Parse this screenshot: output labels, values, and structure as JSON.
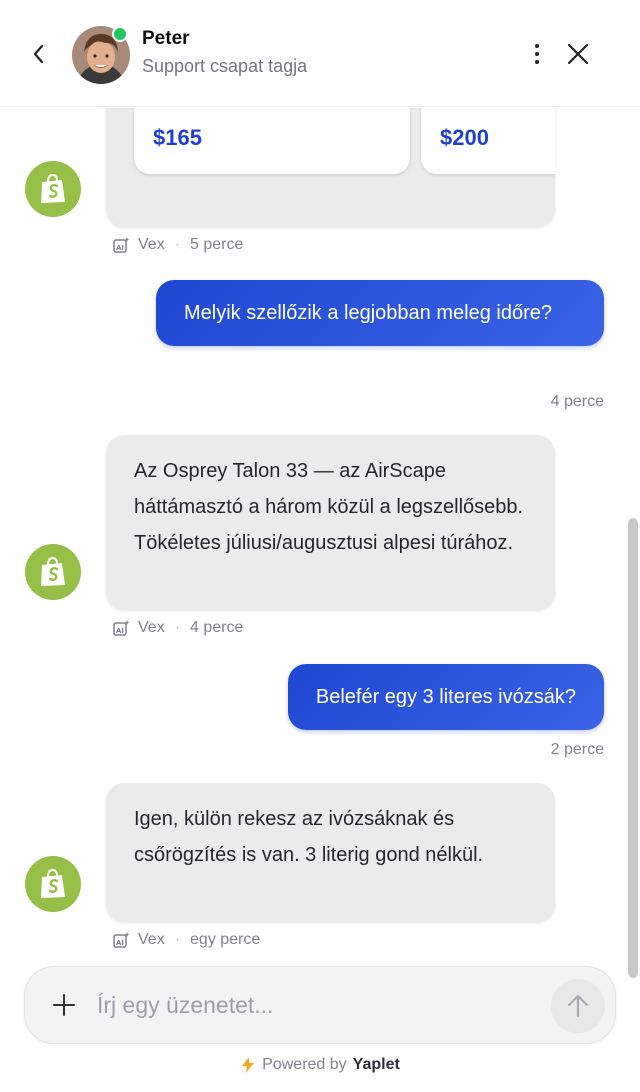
{
  "header": {
    "agent_name": "Peter",
    "agent_role": "Support csapat tagja",
    "status_color": "#22c55e"
  },
  "messages": {
    "carousel": {
      "products": [
        {
          "price": "$165"
        },
        {
          "price": "$200"
        }
      ],
      "sender": "Vex",
      "time": "5 perce"
    },
    "user1": {
      "text": "Melyik szellőzik a legjobban meleg időre?",
      "time": "4 perce"
    },
    "bot1": {
      "text": "Az Osprey Talon 33 — az AirScape háttámasztó a három közül a legszellősebb. Tökéletes júliusi/augusztusi alpesi túrához.",
      "sender": "Vex",
      "time": "4 perce"
    },
    "user2": {
      "text": "Belefér egy 3 literes ivózsák?",
      "time": "2 perce"
    },
    "bot2": {
      "text": "Igen, külön rekesz az ivózsáknak és csőrögzítés is van. 3 literig gond nélkül.",
      "sender": "Vex",
      "time": "egy perce"
    }
  },
  "composer": {
    "placeholder": "Írj egy üzenetet..."
  },
  "footer": {
    "powered_by": "Powered by",
    "brand": "Yaplet"
  },
  "colors": {
    "user_bubble": "#1f47d3",
    "bot_avatar": "#95bf47",
    "price": "#1f3fd0"
  },
  "icons": {
    "bot_avatar": "shopify-bag-icon",
    "meta": "ai-sparkle-icon",
    "footer": "lightning-icon"
  }
}
